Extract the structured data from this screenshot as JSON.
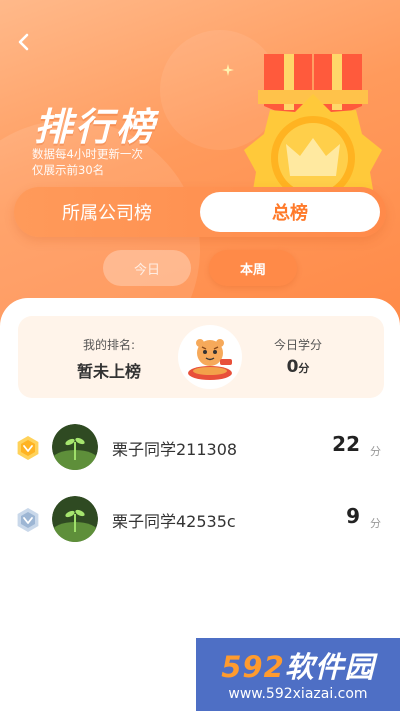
{
  "header": {
    "title": "排行榜",
    "subtitle_line1": "数据每4小时更新一次",
    "subtitle_line2": "仅展示前30名",
    "back_icon": "chevron-left-icon"
  },
  "segment": {
    "tabs": [
      {
        "label": "所属公司榜",
        "selected": false
      },
      {
        "label": "总榜",
        "selected": true
      }
    ]
  },
  "period": {
    "tabs": [
      {
        "label": "今日",
        "selected": false
      },
      {
        "label": "本周",
        "selected": true
      }
    ]
  },
  "my_card": {
    "rank_label": "我的排名:",
    "rank_value": "暂未上榜",
    "score_label": "今日学分",
    "score_value": "0",
    "score_unit": "分"
  },
  "ranking": [
    {
      "name": "栗子同学211308",
      "score": "22",
      "unit": "分",
      "rank_icon": "gold-badge-icon"
    },
    {
      "name": "栗子同学42535c",
      "score": "9",
      "unit": "分",
      "rank_icon": "silver-badge-icon"
    }
  ],
  "watermark": {
    "brand_num": "592",
    "brand_text": "软件园",
    "url": "www.592xiazai.com"
  },
  "colors": {
    "accent": "#ff8a48",
    "accent_text": "#ff7a2a",
    "card_bg": "#fff4ea"
  }
}
